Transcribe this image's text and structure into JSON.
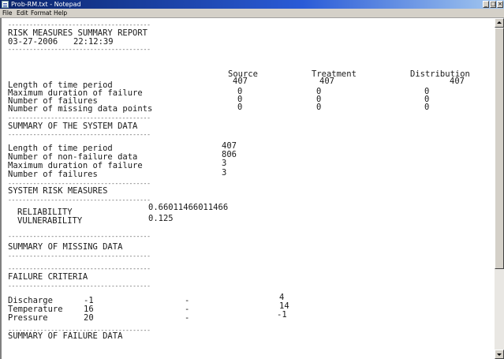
{
  "window": {
    "title": "Prob-RM.txt - Notepad",
    "minimize_glyph": "_",
    "maximize_glyph": "□",
    "close_glyph": "×"
  },
  "menu": [
    "File",
    "Edit",
    "Format",
    "Help"
  ],
  "report": {
    "separator": "----------------------------------------",
    "header_title": "RISK MEASURES SUMMARY REPORT",
    "header_date": "03-27-2006",
    "header_time": "22:12:39",
    "columns": [
      "Source",
      "Treatment",
      "Distribution"
    ],
    "column_rows": [
      {
        "label": "Length of time period",
        "values": [
          "407",
          "407",
          "407"
        ]
      },
      {
        "label": "Maximum duration of failure",
        "values": [
          "0",
          "0",
          "0"
        ]
      },
      {
        "label": "Number of failures",
        "values": [
          "0",
          "0",
          "0"
        ]
      },
      {
        "label": "Number of missing data points",
        "values": [
          "0",
          "0",
          "0"
        ]
      }
    ],
    "system_title": "SUMMARY OF THE SYSTEM DATA",
    "system_rows": [
      {
        "label": "Length of time period",
        "value": "407"
      },
      {
        "label": "Number of non-failure data",
        "value": "806"
      },
      {
        "label": "Maximum duration of failure",
        "value": "3"
      },
      {
        "label": "Number of failures",
        "value": "3"
      }
    ],
    "risk_title": "SYSTEM RISK MEASURES",
    "risk_rows": [
      {
        "label": "RELIABILITY",
        "value": "0.66011466011466"
      },
      {
        "label": "VULNERABILITY",
        "value": "0.125"
      }
    ],
    "missing_title": "SUMMARY OF MISSING DATA",
    "criteria_title": "FAILURE CRITERIA",
    "criteria_rows": [
      {
        "label": "Discharge",
        "low": "-1",
        "dash": "-",
        "high": "4"
      },
      {
        "label": "Temperature",
        "low": "16",
        "dash": "-",
        "high": "14"
      },
      {
        "label": "Pressure",
        "low": "20",
        "dash": "-",
        "high": "-1"
      }
    ],
    "failure_title": "SUMMARY OF FAILURE DATA"
  }
}
